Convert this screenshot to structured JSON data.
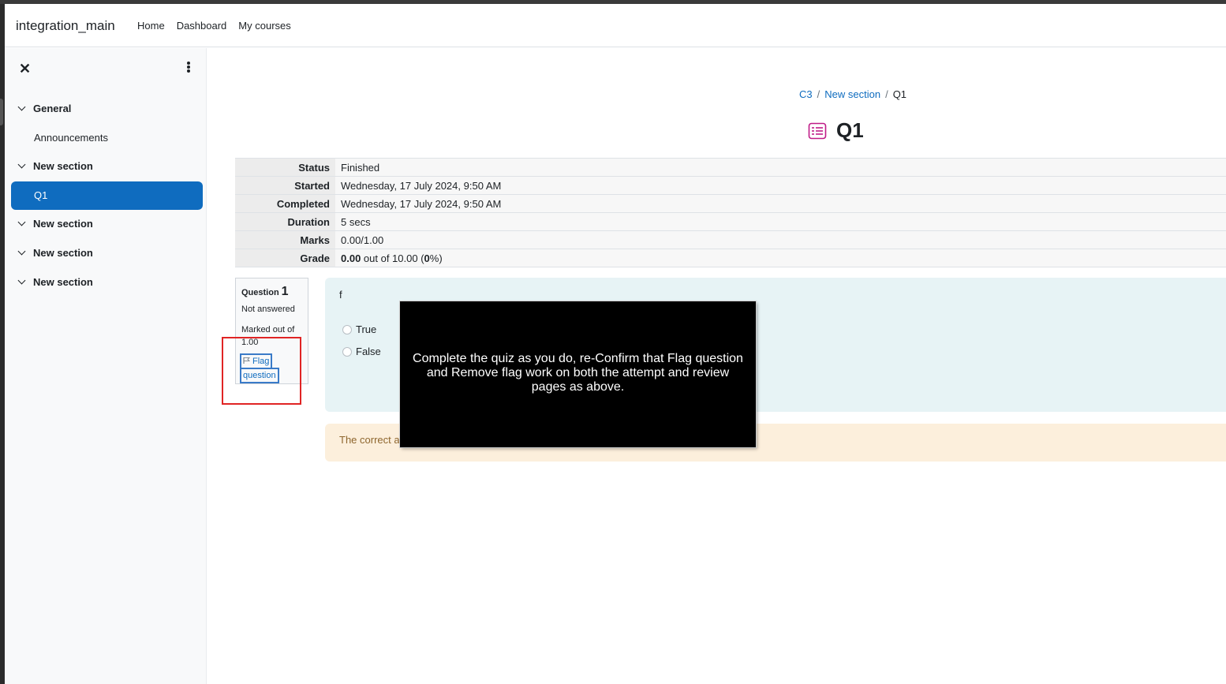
{
  "navbar": {
    "brand": "integration_main",
    "links": [
      "Home",
      "Dashboard",
      "My courses"
    ]
  },
  "drawer": {
    "close_symbol": "✕",
    "sections": [
      {
        "label": "General"
      },
      {
        "label": "New section"
      },
      {
        "label": "New section"
      },
      {
        "label": "New section"
      },
      {
        "label": "New section"
      }
    ],
    "items": [
      "Announcements",
      "Q1"
    ],
    "active_item": "Q1"
  },
  "breadcrumb": {
    "items": [
      "C3",
      "New section",
      "Q1"
    ],
    "separator": "/"
  },
  "page": {
    "title": "Q1"
  },
  "summary": {
    "rows": [
      {
        "label": "Status",
        "value": "Finished"
      },
      {
        "label": "Started",
        "value": "Wednesday, 17 July 2024, 9:50 AM"
      },
      {
        "label": "Completed",
        "value": "Wednesday, 17 July 2024, 9:50 AM"
      },
      {
        "label": "Duration",
        "value": "5 secs"
      },
      {
        "label": "Marks",
        "value": "0.00/1.00"
      }
    ],
    "grade": {
      "label": "Grade",
      "score": "0.00",
      "mid": " out of 10.00 (",
      "percent": "0",
      "end": "%)"
    }
  },
  "question": {
    "label": "Question",
    "number": "1",
    "state": "Not answered",
    "marked": "Marked out of 1.00",
    "flag_line1": "Flag",
    "flag_line2": "question",
    "text": "f",
    "options": [
      "True",
      "False"
    ],
    "feedback": "The correct a"
  },
  "overlay": {
    "text": "Complete the quiz as you do, re-Confirm that Flag question and Remove flag work on both the attempt and review pages as above."
  },
  "colors": {
    "primary": "#0f6cbf",
    "quiz_icon": "#c01c88",
    "formulation_bg": "#e7f3f5",
    "outcome_bg": "#fcefdc",
    "highlight_red": "#e02424"
  }
}
